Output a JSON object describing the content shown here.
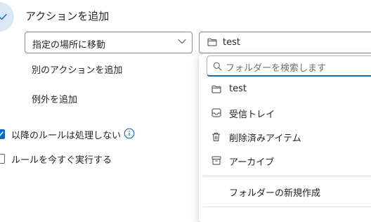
{
  "step": {
    "title": "アクションを追加",
    "check_icon": "checkmark-icon"
  },
  "action": {
    "selected": "指定の場所に移動",
    "chevron_icon": "chevron-down-icon"
  },
  "folder_field": {
    "value": "test",
    "icon": "folder-icon"
  },
  "links": {
    "add_action": "別のアクションを追加",
    "add_exception": "例外を追加"
  },
  "options": {
    "stop_processing": {
      "label": "以降のルールは処理しない",
      "checked": true
    },
    "run_now": {
      "label": "ルールを今すぐ実行する",
      "checked": false
    }
  },
  "folder_menu": {
    "search_placeholder": "フォルダーを検索します",
    "items": [
      {
        "label": "test",
        "icon": "folder-icon"
      },
      {
        "label": "受信トレイ",
        "icon": "inbox-icon"
      },
      {
        "label": "削除済みアイテム",
        "icon": "trash-icon"
      },
      {
        "label": "アーカイブ",
        "icon": "archive-icon"
      }
    ],
    "create_label": "フォルダーの新規作成"
  },
  "colors": {
    "accent": "#0f6cbd",
    "step_circle": "#dbe7f7"
  }
}
